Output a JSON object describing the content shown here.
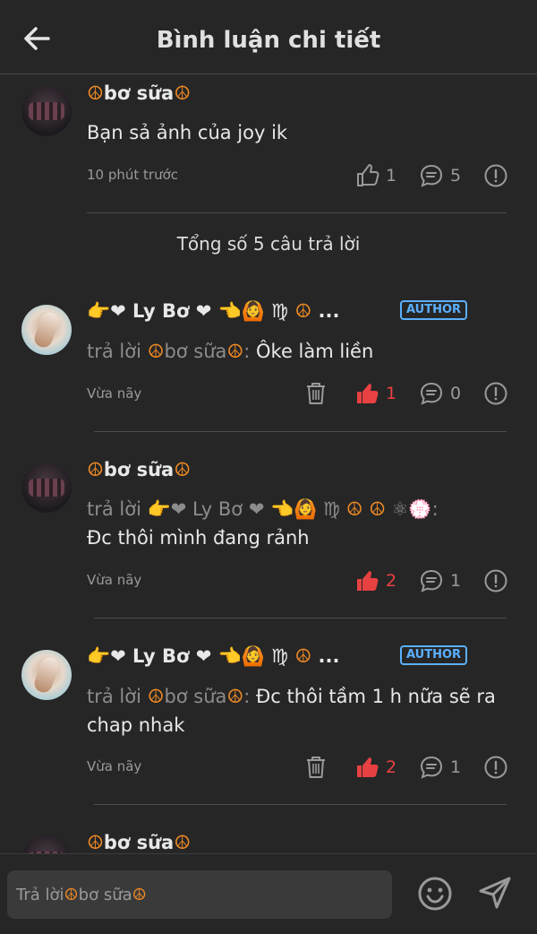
{
  "header": {
    "title": "Bình luận chi tiết"
  },
  "main_comment": {
    "author": "☮bơ sữa☮",
    "text": "Bạn sả ảnh của joy ik",
    "time": "10 phút trước",
    "likes": "1",
    "replies": "5"
  },
  "summary": {
    "total": "Tổng số 5 câu trả lời"
  },
  "replies": [
    {
      "author": "👉❤ Ly Bơ ❤ 👈🙆 ♍ ☮ ...",
      "badge": "AUTHOR",
      "reply_prefix": "trả lời ☮bơ sữa☮:",
      "text": " Ôke làm liền",
      "time": "Vừa nãy",
      "likes": "1",
      "comments": "0"
    },
    {
      "author": "☮bơ sữa☮",
      "reply_prefix": "trả lời 👉❤ Ly Bơ ❤ 👈🙆 ♍ ☮ ☮ ⚛💮:",
      "text": "Đc thôi mình đang rảnh",
      "time": "Vừa nãy",
      "likes": "2",
      "comments": "1"
    },
    {
      "author": "👉❤ Ly Bơ ❤ 👈🙆 ♍ ☮ ...",
      "badge": "AUTHOR",
      "reply_prefix": "trả lời ☮bơ sữa☮:",
      "text": " Đc thôi tầm 1 h nữa sẽ ra chap nhak",
      "time": "Vừa nãy",
      "likes": "2",
      "comments": "1"
    },
    {
      "author": "☮bơ sữa☮"
    }
  ],
  "composer": {
    "placeholder": "Trả lời ☮bơ sữa☮"
  },
  "colors": {
    "background": "#262626",
    "liked": "#e84141",
    "author_badge": "#5ab0ff",
    "peace": "#f08a24"
  }
}
